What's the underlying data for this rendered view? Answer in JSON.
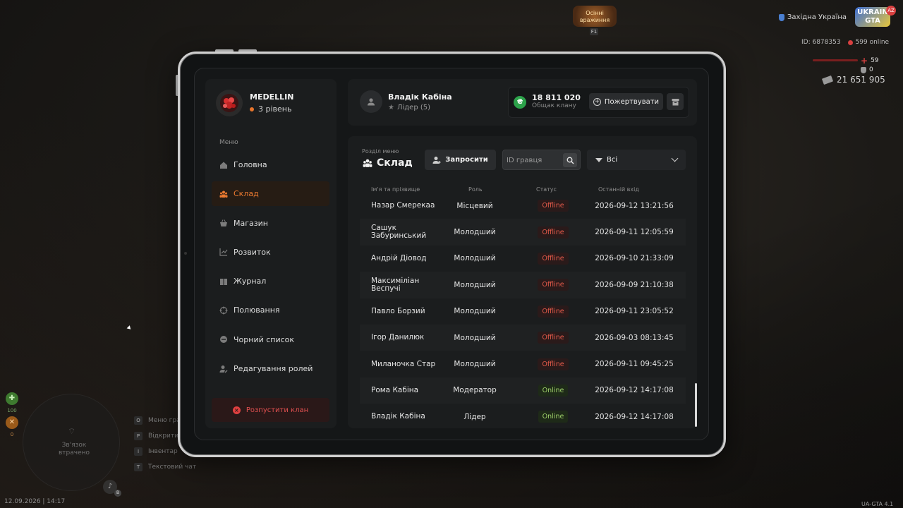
{
  "hud": {
    "server_name": "Західна Україна",
    "logo_text": "UKRAIN GTA",
    "logo_badge": "AZ",
    "event_text": "Осінні вражиння",
    "event_key": "F1",
    "player_id": "ID: 6878353",
    "online": "599 online",
    "health": "59",
    "armor": "0",
    "money": "21 651 905",
    "status_icon_values": [
      "100",
      "0"
    ],
    "map_text": "Зв'язок втрачено",
    "mic_key": "B",
    "hotkeys": [
      {
        "key": "O",
        "label": "Меню гравця"
      },
      {
        "key": "P",
        "label": "Відкрити телефон"
      },
      {
        "key": "I",
        "label": "Інвентар"
      },
      {
        "key": "T",
        "label": "Текстовий чат"
      }
    ],
    "datetime": "12.09.2026 | 14:17",
    "version": "UA-GTA 4.1"
  },
  "sidebar": {
    "clan_name": "MEDELLIN",
    "clan_level": "3 рівень",
    "menu_label": "Меню",
    "items": [
      {
        "label": "Головна",
        "icon": "home-icon",
        "active": false
      },
      {
        "label": "Склад",
        "icon": "people-icon",
        "active": true
      },
      {
        "label": "Магазин",
        "icon": "basket-icon",
        "active": false
      },
      {
        "label": "Розвиток",
        "icon": "chart-icon",
        "active": false
      },
      {
        "label": "Журнал",
        "icon": "book-icon",
        "active": false
      },
      {
        "label": "Полювання",
        "icon": "crosshair-icon",
        "active": false
      },
      {
        "label": "Чорний список",
        "icon": "minus-circle-icon",
        "active": false
      },
      {
        "label": "Редагування ролей",
        "icon": "user-edit-icon",
        "active": false
      }
    ],
    "dissolve_label": "Розпустити клан"
  },
  "header": {
    "user_name": "Владік Кабіна",
    "user_role": "Лідер (5)",
    "bank_amount": "18 811 020",
    "bank_label": "Общак клану",
    "donate_label": "Пожертвувати"
  },
  "main": {
    "section_label": "Розділ меню",
    "section_title": "Склад",
    "invite_label": "Запросити",
    "search_placeholder": "ID гравця",
    "filter_value": "Всі",
    "columns": [
      "Ім'я та прізвище",
      "Роль",
      "Статус",
      "Останній вхід"
    ],
    "rows": [
      {
        "name": "Назар Смерекаа",
        "role": "Місцевий",
        "status": "Offline",
        "last": "2026-09-12 13:21:56"
      },
      {
        "name": "Сашук Забуринський",
        "role": "Молодший",
        "status": "Offline",
        "last": "2026-09-11 12:05:59"
      },
      {
        "name": "Андрій Діовод",
        "role": "Молодший",
        "status": "Offline",
        "last": "2026-09-10 21:33:09"
      },
      {
        "name": "Максиміліан Веспучі",
        "role": "Молодший",
        "status": "Offline",
        "last": "2026-09-09 21:10:38"
      },
      {
        "name": "Павло Борзий",
        "role": "Молодший",
        "status": "Offline",
        "last": "2026-09-11 23:05:52"
      },
      {
        "name": "Ігор Данилюк",
        "role": "Молодший",
        "status": "Offline",
        "last": "2026-09-03 08:13:45"
      },
      {
        "name": "Миланочка Стар",
        "role": "Молодший",
        "status": "Offline",
        "last": "2026-09-11 09:45:25"
      },
      {
        "name": "Рома Кабіна",
        "role": "Модератор",
        "status": "Online",
        "last": "2026-09-12 14:17:08"
      },
      {
        "name": "Владік Кабіна",
        "role": "Лідер",
        "status": "Online",
        "last": "2026-09-12 14:17:08"
      }
    ]
  },
  "colors": {
    "accent": "#ec7a30",
    "offline": "#e35a4a",
    "online": "#9fd06a",
    "coin": "#2ca24a"
  }
}
